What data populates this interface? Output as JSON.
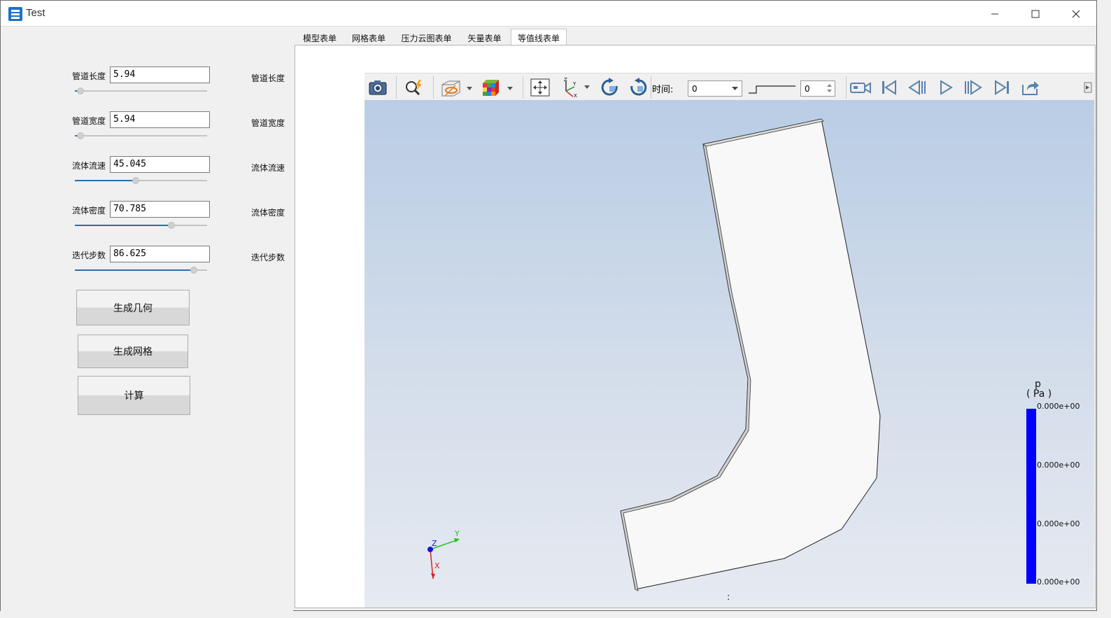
{
  "window": {
    "title": "Test",
    "minimize_icon": "minimize-icon",
    "maximize_icon": "maximize-icon",
    "close_icon": "close-icon"
  },
  "params": [
    {
      "label": "管道长度",
      "value": "5.94",
      "slider_fraction": 0.04,
      "side_label": "管道长度"
    },
    {
      "label": "管道宽度",
      "value": "5.94",
      "slider_fraction": 0.04,
      "side_label": "管道宽度"
    },
    {
      "label": "流体流速",
      "value": "45.045",
      "slider_fraction": 0.46,
      "side_label": "流体流速"
    },
    {
      "label": "流体密度",
      "value": "70.785",
      "slider_fraction": 0.73,
      "side_label": "流体密度"
    },
    {
      "label": "迭代步数",
      "value": "86.625",
      "slider_fraction": 0.9,
      "side_label": "迭代步数"
    }
  ],
  "buttons": {
    "geometry": "生成几何",
    "mesh": "生成网格",
    "compute": "计算"
  },
  "tabs": [
    {
      "label": "模型表单",
      "active": false
    },
    {
      "label": "网格表单",
      "active": false
    },
    {
      "label": "压力云图表单",
      "active": false
    },
    {
      "label": "矢量表单",
      "active": false
    },
    {
      "label": "等值线表单",
      "active": true
    }
  ],
  "toolbar": {
    "time_label": "时间:",
    "time_value": "0",
    "spin_value": "0",
    "icons": [
      "camera-icon",
      "zoom-icon",
      "slice-icon",
      "color-cube-icon",
      "fit-view-icon",
      "axes-icon",
      "rotate-cw-icon",
      "rotate-ccw-icon",
      "record-icon",
      "first-frame-icon",
      "prev-frame-icon",
      "play-icon",
      "next-frame-icon",
      "last-frame-icon",
      "export-icon"
    ]
  },
  "viewport": {
    "bottom_text": ":",
    "axes": {
      "x": "X",
      "y": "Y",
      "z": "Z"
    },
    "colors": {
      "bg_top": "#b9cde5",
      "bg_bottom": "#e6eaf1",
      "shape_fill": "#f8f8f8",
      "legend_bar": "#0000ff"
    }
  },
  "legend": {
    "title_line1": "p",
    "title_line2": "( Pa )",
    "labels": [
      "0.000e+00",
      "0.000e+00",
      "0.000e+00",
      "0.000e+00"
    ]
  }
}
